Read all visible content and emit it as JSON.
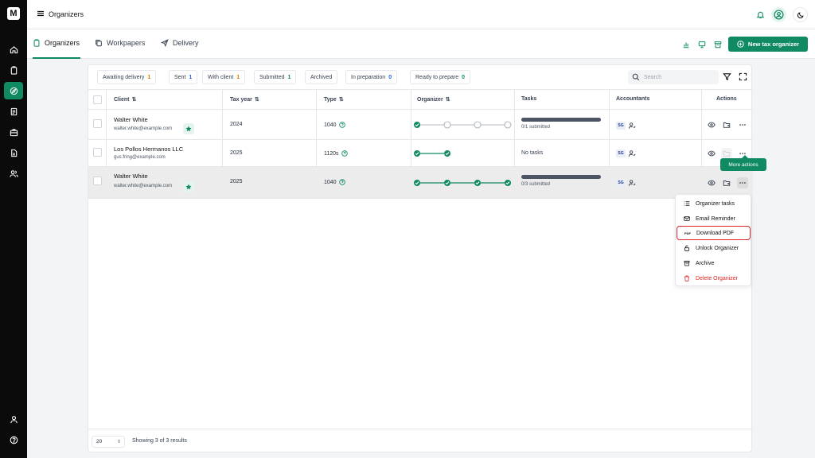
{
  "app": {
    "title": "Organizers",
    "logo": "M"
  },
  "rail": {
    "items": [
      "home-icon",
      "clipboard-icon",
      "compass-icon",
      "document-icon",
      "briefcase-icon",
      "file-icon",
      "users-icon"
    ],
    "bottom": [
      "user-icon",
      "help-icon"
    ]
  },
  "tabs": [
    {
      "label": "Organizers",
      "icon": "clipboard-icon",
      "active": true
    },
    {
      "label": "Workpapers",
      "icon": "copy-icon",
      "active": false
    },
    {
      "label": "Delivery",
      "icon": "send-icon",
      "active": false
    }
  ],
  "toolbar": {
    "new_label": "New tax organizer"
  },
  "filters": [
    {
      "label": "Awaiting delivery",
      "count": "1",
      "color": "#d97706"
    },
    {
      "label": "Sent",
      "count": "1",
      "color": "#2563eb"
    },
    {
      "label": "With client",
      "count": "1",
      "color": "#d97706"
    },
    {
      "label": "Submitted",
      "count": "1",
      "color": "#0f8a63"
    },
    {
      "label": "Archived",
      "count": "",
      "color": "#374151"
    },
    {
      "label": "In preparation",
      "count": "0",
      "color": "#2563eb"
    },
    {
      "label": "Ready to prepare",
      "count": "0",
      "color": "#0f8a63"
    }
  ],
  "search": {
    "placeholder": "Search"
  },
  "columns": {
    "client": "Client",
    "tax_year": "Tax year",
    "type": "Type",
    "organizer": "Organizer",
    "tasks": "Tasks",
    "accountants": "Accountants",
    "actions": "Actions"
  },
  "rows": [
    {
      "name": "Walter White",
      "email": "walter.white@example.com",
      "starred": true,
      "year": "2024",
      "type": "1040",
      "steps_done": 1,
      "steps_total": 4,
      "tasks": "0/1 submitted",
      "has_bar": true,
      "accountant": "SG"
    },
    {
      "name": "Los Pollos Hermanos LLC",
      "email": "gus.fring@example.com",
      "starred": false,
      "year": "2025",
      "type": "1120s",
      "steps_done": 2,
      "steps_total": 2,
      "tasks": "No tasks",
      "has_bar": false,
      "accountant": "SG"
    },
    {
      "name": "Walter White",
      "email": "walter.white@example.com",
      "starred": true,
      "year": "2025",
      "type": "1040",
      "steps_done": 4,
      "steps_total": 4,
      "tasks": "0/3 submitted",
      "has_bar": true,
      "accountant": "SG"
    }
  ],
  "tooltip": "More actions",
  "menu": [
    {
      "label": "Organizer tasks",
      "icon": "list-icon"
    },
    {
      "label": "Email Reminder",
      "icon": "mail-icon"
    },
    {
      "label": "Download PDF",
      "icon": "pdf-icon"
    },
    {
      "label": "Unlock Organizer",
      "icon": "unlock-icon"
    },
    {
      "label": "Archive",
      "icon": "archive-icon"
    },
    {
      "label": "Delete Organizer",
      "icon": "trash-icon"
    }
  ],
  "footer": {
    "page_size": "20",
    "summary": "Showing 3 of 3 results"
  },
  "colors": {
    "brand": "#0f8a63",
    "danger": "#dc2626"
  }
}
